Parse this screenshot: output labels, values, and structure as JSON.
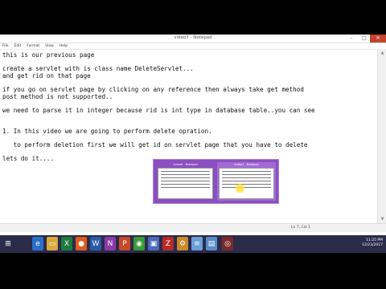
{
  "window": {
    "title": "video7 - Notepad",
    "controls": {
      "minimize": "–",
      "maximize": "□",
      "close": "✕"
    }
  },
  "menu": [
    "File",
    "Edit",
    "Format",
    "View",
    "Help"
  ],
  "editor": {
    "lines": [
      "this is our previous page",
      "",
      "create a servlet with is class name DeleteServlet...",
      "and get rid on that page",
      "",
      "if you go on servlet page by clicking on any reference then always take get method",
      "post method is not supported..",
      "",
      "we need to parse it in integer because rid is int type in database table..you can see",
      "",
      "",
      "1. In this video we are going to perform delete opration.",
      "",
      "   to perform deletion first we will get id on servlet page that you have to delete",
      "",
      "lets do it...."
    ]
  },
  "statusbar": {
    "position": "Ln 7, Col 1"
  },
  "taskbar": {
    "icons": [
      {
        "name": "start-icon",
        "glyph": "⊞",
        "color": "#2b2b4a"
      },
      {
        "name": "ie-icon",
        "glyph": "e",
        "color": "#2a6fc9"
      },
      {
        "name": "folder-icon",
        "glyph": "▭",
        "color": "#d9a83a"
      },
      {
        "name": "excel-icon",
        "glyph": "X",
        "color": "#1e7a3c"
      },
      {
        "name": "media-icon",
        "glyph": "●",
        "color": "#e05a1a"
      },
      {
        "name": "word-icon",
        "glyph": "W",
        "color": "#2a5aa8"
      },
      {
        "name": "onenote-icon",
        "glyph": "N",
        "color": "#8a3aa8"
      },
      {
        "name": "powerpoint-icon",
        "glyph": "P",
        "color": "#c9482a"
      },
      {
        "name": "chrome-icon",
        "glyph": "◉",
        "color": "#3a9a3a"
      },
      {
        "name": "app-icon",
        "glyph": "▣",
        "color": "#4a6ab8"
      },
      {
        "name": "filezilla-icon",
        "glyph": "Z",
        "color": "#b82a2a"
      },
      {
        "name": "tool-icon",
        "glyph": "⚙",
        "color": "#c98a2a"
      },
      {
        "name": "notepad-icon",
        "glyph": "≡",
        "color": "#6aa0d8"
      },
      {
        "name": "doc-icon",
        "glyph": "▤",
        "color": "#5a8ac8"
      },
      {
        "name": "recorder-icon",
        "glyph": "◎",
        "color": "#7a2a2a"
      }
    ],
    "time": "11:25 PM",
    "date": "12/23/2017"
  },
  "preview": {
    "thumbs": [
      {
        "title": "video6 - Notepad"
      },
      {
        "title": "video7 - Notepad"
      }
    ]
  }
}
